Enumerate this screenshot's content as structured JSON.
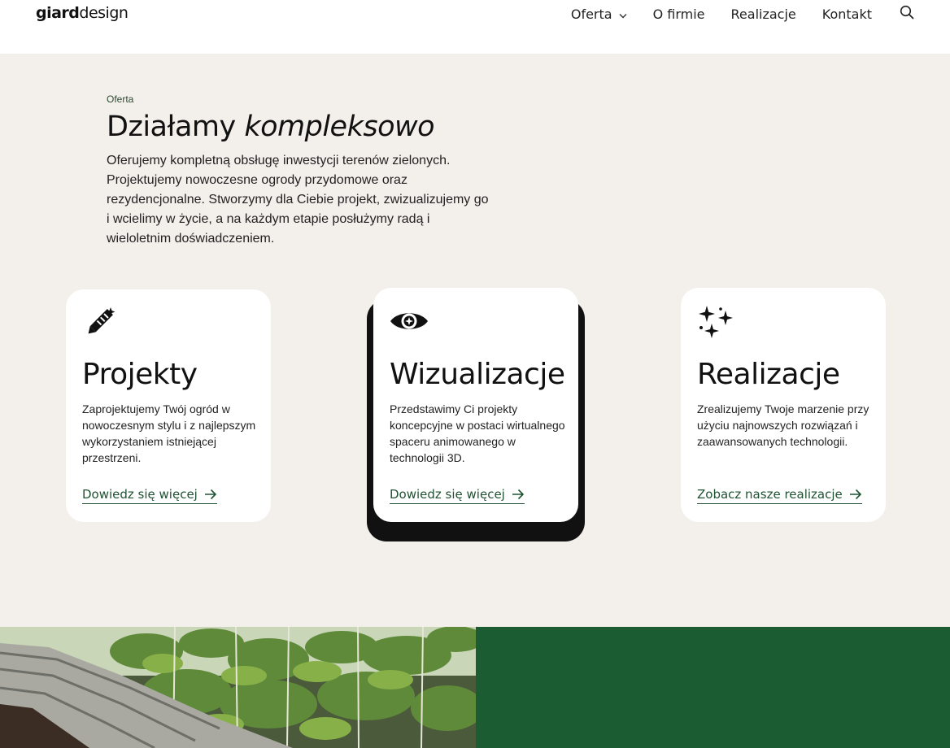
{
  "header": {
    "logo_bold": "giard",
    "logo_light": "design",
    "nav": [
      {
        "label": "Oferta"
      },
      {
        "label": "O firmie"
      },
      {
        "label": "Realizacje"
      },
      {
        "label": "Kontakt"
      }
    ]
  },
  "intro": {
    "eyebrow": "Oferta",
    "headline_regular": "Działamy",
    "headline_italic": "kompleksowo",
    "lead": "Oferujemy kompletną obsługę inwestycji terenów zielonych. Projektujemy nowoczesne ogrody przydomowe oraz rezydencjonalne. Stworzymy dla Ciebie projekt, zwizualizujemy go i wcielimy w życie, a na każdym etapie posłużymy radą i wieloletnim doświadczeniem."
  },
  "cards": [
    {
      "icon": "pencil-ruler-icon",
      "title": "Projekty",
      "text": "Zaprojektujemy Twój ogród w nowoczesnym stylu i z najlepszym wykorzystaniem istniejącej przestrzeni.",
      "link": "Dowiedz się więcej"
    },
    {
      "icon": "eye-icon",
      "title": "Wizualizacje",
      "text": "Przedstawimy Ci projekty koncepcyjne w postaci wirtualnego spaceru animowanego w technologii 3D.",
      "link": "Dowiedz się więcej"
    },
    {
      "icon": "sparkles-icon",
      "title": "Realizacje",
      "text": "Zrealizujemy Twoje marzenie przy użyciu najnowszych rozwiązań i zaawansowanych technologii.",
      "link": "Zobacz nasze realizacje"
    }
  ],
  "colors": {
    "section_bg": "#f3efeb",
    "accent_green": "#1b5c32",
    "link_green": "#1f5232"
  }
}
